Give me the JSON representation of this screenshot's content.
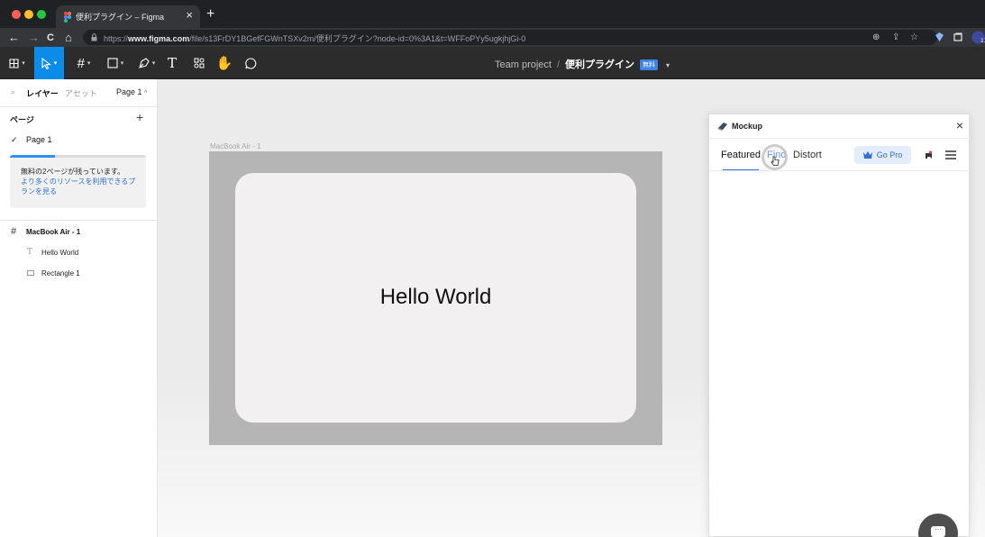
{
  "browser": {
    "traffic_lights": {
      "close": "#ff5f57",
      "minimize": "#febc2e",
      "maximize": "#28c840"
    },
    "tab_title": "便利プラグイン – Figma",
    "tab_close": "×",
    "new_tab": "+",
    "url_prefix": "https://",
    "url_host": "www.figma.com",
    "url_path": "/file/s13FrDY1BGefFGWnTSXv2m/便利プラグイン?node-id=0%3A1&t=WFFoPYy5ugkjhjGi-0",
    "nav": {
      "back": "←",
      "forward": "→",
      "reload": "C",
      "home": "⌂"
    }
  },
  "figma_toolbar": {
    "project": "Team project",
    "separator": "/",
    "file_name": "便利プラグイン",
    "badge": "無料",
    "accent": "#0c8ce9"
  },
  "left_panel": {
    "tab_layers": "レイヤー",
    "tab_assets": "アセット",
    "page_selector": "Page 1",
    "pages_header": "ページ",
    "add_page": "+",
    "pages": [
      "Page 1"
    ],
    "notice": {
      "text": "無料の2ページが残っています。",
      "link": "より多くのリソースを利用できるプランを見る",
      "progress": 0.33
    },
    "layers": [
      {
        "name": "MacBook Air - 1",
        "icon": "frame-icon"
      },
      {
        "name": "Hello World",
        "icon": "text-icon"
      },
      {
        "name": "Rectangle 1",
        "icon": "rectangle-icon"
      }
    ]
  },
  "canvas": {
    "frame_label": "MacBook Air - 1",
    "hello_text": "Hello World"
  },
  "plugin": {
    "title": "Mockup",
    "close": "×",
    "tabs": [
      "Featured",
      "Find",
      "Distort"
    ],
    "active_tab": "Featured",
    "go_pro": "Go Pro",
    "chat_dots": "···"
  }
}
